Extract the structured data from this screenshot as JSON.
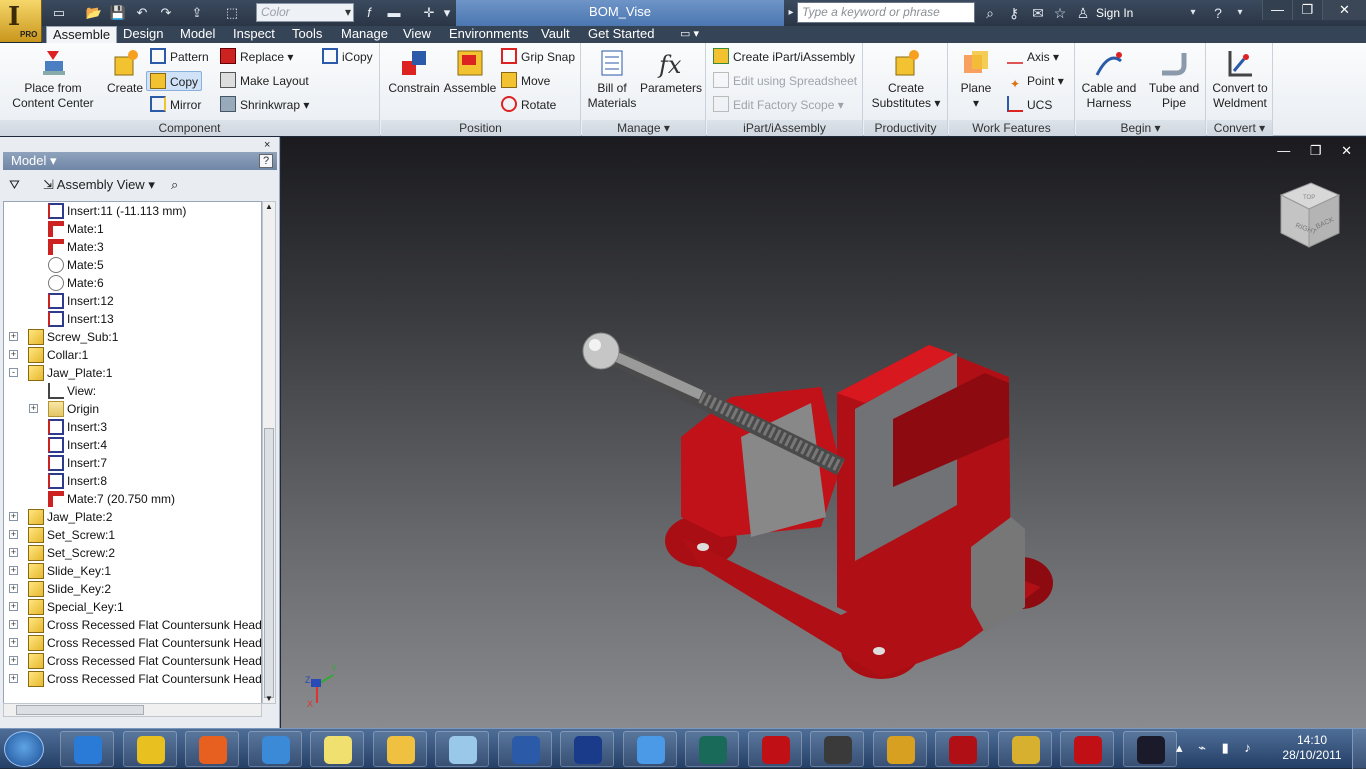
{
  "titlebar": {
    "color_field": "Color",
    "document_title": "BOM_Vise",
    "search_placeholder": "Type a keyword or phrase",
    "sign_in": "Sign In",
    "logo_label": "PRO"
  },
  "tabs": [
    {
      "label": "Assemble",
      "active": true
    },
    {
      "label": "Design"
    },
    {
      "label": "Model"
    },
    {
      "label": "Inspect"
    },
    {
      "label": "Tools"
    },
    {
      "label": "Manage"
    },
    {
      "label": "View"
    },
    {
      "label": "Environments"
    },
    {
      "label": "Vault"
    },
    {
      "label": "Get Started"
    }
  ],
  "ribbon": {
    "component": {
      "title": "Component",
      "place": "Place from",
      "place2": "Content Center",
      "create": "Create",
      "pattern": "Pattern",
      "copy": "Copy",
      "mirror": "Mirror",
      "replace": "Replace",
      "make_layout": "Make Layout",
      "shrinkwrap": "Shrinkwrap",
      "icopy": "iCopy"
    },
    "position": {
      "title": "Position",
      "constrain": "Constrain",
      "assemble": "Assemble",
      "grip_snap": "Grip Snap",
      "move": "Move",
      "rotate": "Rotate"
    },
    "manage": {
      "title": "Manage",
      "bom": "Bill of",
      "bom2": "Materials",
      "parameters": "Parameters"
    },
    "ipart": {
      "title": "iPart/iAssembly",
      "create": "Create iPart/iAssembly",
      "edit_spreadsheet": "Edit using Spreadsheet",
      "edit_scope": "Edit Factory Scope"
    },
    "productivity": {
      "title": "Productivity",
      "create_subs": "Create",
      "create_subs2": "Substitutes"
    },
    "work": {
      "title": "Work Features",
      "plane": "Plane",
      "axis": "Axis",
      "point": "Point",
      "ucs": "UCS"
    },
    "begin": {
      "title": "Begin",
      "cable": "Cable and",
      "cable2": "Harness",
      "tube": "Tube and",
      "tube2": "Pipe"
    },
    "convert": {
      "title": "Convert",
      "weldment": "Convert to",
      "weldment2": "Weldment"
    }
  },
  "browser": {
    "header": "Model",
    "view_mode": "Assembly View",
    "help": "?",
    "close": "×",
    "tree": [
      {
        "label": "Insert:11 (-11.113 mm)",
        "icon": "insert",
        "level": 2
      },
      {
        "label": "Mate:1",
        "icon": "mate",
        "level": 2
      },
      {
        "label": "Mate:3",
        "icon": "mate",
        "level": 2
      },
      {
        "label": "Mate:5",
        "icon": "angle",
        "level": 2
      },
      {
        "label": "Mate:6",
        "icon": "angle",
        "level": 2
      },
      {
        "label": "Insert:12",
        "icon": "insert",
        "level": 2
      },
      {
        "label": "Insert:13",
        "icon": "insert",
        "level": 2
      },
      {
        "label": "Screw_Sub:1",
        "icon": "part",
        "level": 1,
        "expander": "+"
      },
      {
        "label": "Collar:1",
        "icon": "part",
        "level": 1,
        "expander": "+"
      },
      {
        "label": "Jaw_Plate:1",
        "icon": "part",
        "level": 1,
        "expander": "-"
      },
      {
        "label": "View:",
        "icon": "view",
        "level": 2
      },
      {
        "label": "Origin",
        "icon": "folder",
        "level": 2,
        "expander": "+"
      },
      {
        "label": "Insert:3",
        "icon": "insert",
        "level": 2
      },
      {
        "label": "Insert:4",
        "icon": "insert",
        "level": 2
      },
      {
        "label": "Insert:7",
        "icon": "insert",
        "level": 2
      },
      {
        "label": "Insert:8",
        "icon": "insert",
        "level": 2
      },
      {
        "label": "Mate:7 (20.750 mm)",
        "icon": "mate",
        "level": 2
      },
      {
        "label": "Jaw_Plate:2",
        "icon": "part",
        "level": 1,
        "expander": "+"
      },
      {
        "label": "Set_Screw:1",
        "icon": "part",
        "level": 1,
        "expander": "+"
      },
      {
        "label": "Set_Screw:2",
        "icon": "part",
        "level": 1,
        "expander": "+"
      },
      {
        "label": "Slide_Key:1",
        "icon": "part",
        "level": 1,
        "expander": "+"
      },
      {
        "label": "Slide_Key:2",
        "icon": "part",
        "level": 1,
        "expander": "+"
      },
      {
        "label": "Special_Key:1",
        "icon": "part",
        "level": 1,
        "expander": "+"
      },
      {
        "label": "Cross Recessed Flat Countersunk Head Mac",
        "icon": "part",
        "level": 1,
        "expander": "+"
      },
      {
        "label": "Cross Recessed Flat Countersunk Head Mac",
        "icon": "part",
        "level": 1,
        "expander": "+"
      },
      {
        "label": "Cross Recessed Flat Countersunk Head Mac",
        "icon": "part",
        "level": 1,
        "expander": "+"
      },
      {
        "label": "Cross Recessed Flat Countersunk Head Mac",
        "icon": "part",
        "level": 1,
        "expander": "+"
      }
    ]
  },
  "viewcube": {
    "right": "RIGHT",
    "back": "BACK",
    "top": "TOP"
  },
  "triad": {
    "z": "Z",
    "y": "Y",
    "x": "X"
  },
  "taskbar": {
    "time": "14:10",
    "date": "28/10/2011",
    "apps": [
      "internet-explorer",
      "chrome",
      "firefox",
      "media-player",
      "sticky-notes",
      "file-explorer",
      "paint",
      "word",
      "crown-app",
      "dropbox",
      "3ds-max",
      "autocad",
      "maya",
      "autocad-d",
      "solidworks-sed",
      "inventor",
      "solidworks",
      "obs"
    ]
  },
  "colors": {
    "accent_red": "#b01015",
    "ribbon_bg": "#eef1f5",
    "viewport_top": "#1b1b1f",
    "viewport_bottom": "#8a8b8e"
  }
}
